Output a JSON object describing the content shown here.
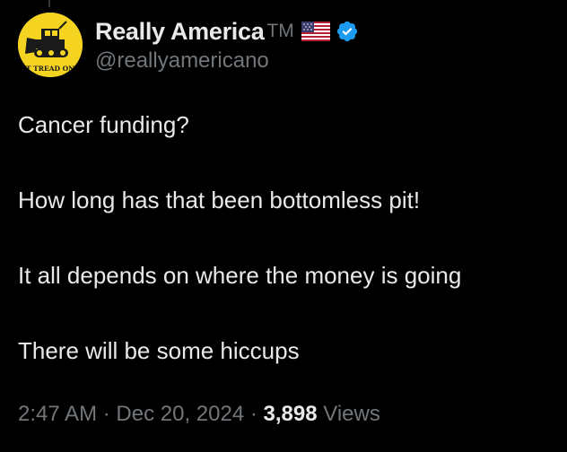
{
  "author": {
    "display_name": "Really America",
    "tm_mark": "TM",
    "handle": "@reallyamericano",
    "avatar_text": "T TREAD ON"
  },
  "tweet": {
    "lines": [
      "Cancer funding?",
      "How long has that been bottomless pit!",
      "It all depends on where the money is going",
      "There will be some hiccups"
    ]
  },
  "meta": {
    "time": "2:47 AM",
    "separator": "·",
    "date": "Dec 20, 2024",
    "views_count": "3,898",
    "views_label": "Views"
  },
  "icons": {
    "flag": "us-flag-icon",
    "verified": "verified-badge-icon"
  },
  "colors": {
    "background": "#000000",
    "text_primary": "#e7e9ea",
    "text_secondary": "#71767b",
    "verified_blue": "#1d9bf0",
    "avatar_yellow": "#f5d321"
  }
}
